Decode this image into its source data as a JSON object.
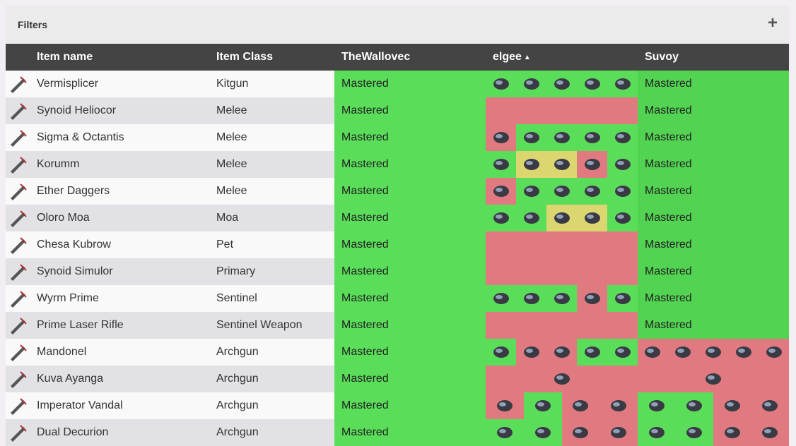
{
  "filters": {
    "title": "Filters",
    "add": "+"
  },
  "columns": {
    "name": "Item name",
    "class": "Item Class",
    "p1": "TheWallovec",
    "p2": "elgee",
    "p2_sort": "▲",
    "p3": "Suvoy"
  },
  "status_text": "Mastered",
  "colors": {
    "mastered": "#5ade5a",
    "missing": "#e07a80",
    "partial": "#dcd670",
    "header": "#444444"
  },
  "rows": [
    {
      "name": "Vermisplicer",
      "class": "Kitgun",
      "p1": "Mastered",
      "p2_parts": [
        "G",
        "G",
        "G",
        "G",
        "G"
      ],
      "p3": "Mastered"
    },
    {
      "name": "Synoid Heliocor",
      "class": "Melee",
      "p1": "Mastered",
      "p2_parts": [
        "R"
      ],
      "p3": "Mastered"
    },
    {
      "name": "Sigma & Octantis",
      "class": "Melee",
      "p1": "Mastered",
      "p2_parts": [
        "R",
        "G",
        "G",
        "G",
        "G"
      ],
      "p3": "Mastered"
    },
    {
      "name": "Korumm",
      "class": "Melee",
      "p1": "Mastered",
      "p2_parts": [
        "G",
        "Y",
        "Y",
        "R",
        "G"
      ],
      "p3": "Mastered"
    },
    {
      "name": "Ether Daggers",
      "class": "Melee",
      "p1": "Mastered",
      "p2_parts": [
        "R",
        "G",
        "G",
        "G",
        "G"
      ],
      "p3": "Mastered"
    },
    {
      "name": "Oloro Moa",
      "class": "Moa",
      "p1": "Mastered",
      "p2_parts": [
        "G",
        "G",
        "Y",
        "Y",
        "G"
      ],
      "p3": "Mastered"
    },
    {
      "name": "Chesa Kubrow",
      "class": "Pet",
      "p1": "Mastered",
      "p2_parts": [
        "R"
      ],
      "p3": "Mastered"
    },
    {
      "name": "Synoid Simulor",
      "class": "Primary",
      "p1": "Mastered",
      "p2_parts": [
        "R"
      ],
      "p3": "Mastered"
    },
    {
      "name": "Wyrm Prime",
      "class": "Sentinel",
      "p1": "Mastered",
      "p2_parts": [
        "G",
        "G",
        "G",
        "R",
        "G"
      ],
      "p3": "Mastered"
    },
    {
      "name": "Prime Laser Rifle",
      "class": "Sentinel Weapon",
      "p1": "Mastered",
      "p2_parts": [
        "R"
      ],
      "p3": "Mastered"
    },
    {
      "name": "Mandonel",
      "class": "Archgun",
      "p1": "Mastered",
      "p2_parts": [
        "G",
        "R",
        "R",
        "G",
        "G"
      ],
      "p3_parts": [
        "R",
        "R",
        "R",
        "R",
        "R"
      ]
    },
    {
      "name": "Kuva Ayanga",
      "class": "Archgun",
      "p1": "Mastered",
      "p2_parts": [
        "R"
      ],
      "p3_parts": [
        "R"
      ]
    },
    {
      "name": "Imperator Vandal",
      "class": "Archgun",
      "p1": "Mastered",
      "p2_parts": [
        "R",
        "G",
        "R",
        "R"
      ],
      "p3_parts": [
        "G",
        "G",
        "R",
        "R"
      ]
    },
    {
      "name": "Dual Decurion",
      "class": "Archgun",
      "p1": "Mastered",
      "p2_parts": [
        "G",
        "G",
        "R",
        "R"
      ],
      "p3_parts": [
        "G",
        "G",
        "R",
        "R"
      ]
    }
  ]
}
